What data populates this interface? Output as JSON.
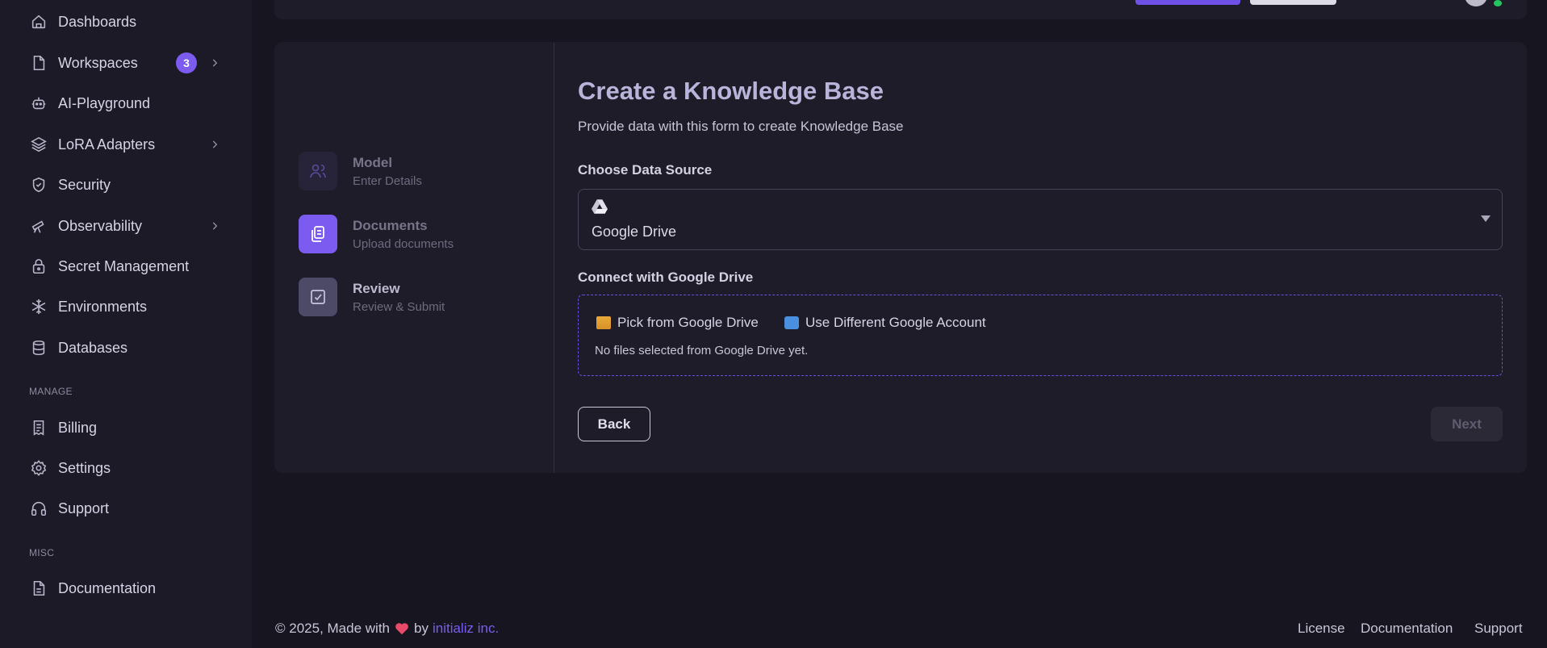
{
  "sidebar": {
    "items": [
      {
        "label": "Dashboards",
        "icon": "home-icon"
      },
      {
        "label": "Workspaces",
        "icon": "file-icon",
        "badge": "3"
      },
      {
        "label": "AI-Playground",
        "icon": "robot-icon"
      },
      {
        "label": "LoRA Adapters",
        "icon": "layers-icon"
      },
      {
        "label": "Security",
        "icon": "shield-check-icon"
      },
      {
        "label": "Observability",
        "icon": "telescope-icon"
      },
      {
        "label": "Secret Management",
        "icon": "lock-icon"
      },
      {
        "label": "Environments",
        "icon": "snowflake-icon"
      },
      {
        "label": "Databases",
        "icon": "database-icon"
      }
    ],
    "manage_heading": "MANAGE",
    "manage_items": [
      {
        "label": "Billing",
        "icon": "receipt-icon"
      },
      {
        "label": "Settings",
        "icon": "gear-icon"
      },
      {
        "label": "Support",
        "icon": "headphones-icon"
      }
    ],
    "misc_heading": "MISC",
    "misc_items": [
      {
        "label": "Documentation",
        "icon": "document-icon"
      }
    ]
  },
  "stepper": {
    "steps": [
      {
        "title": "Model",
        "subtitle": "Enter Details",
        "icon": "users-icon",
        "state": "done"
      },
      {
        "title": "Documents",
        "subtitle": "Upload documents",
        "icon": "copy-icon",
        "state": "active"
      },
      {
        "title": "Review",
        "subtitle": "Review & Submit",
        "icon": "check-square-icon",
        "state": "pending"
      }
    ]
  },
  "form": {
    "title": "Create a Knowledge Base",
    "subtitle": "Provide data with this form to create Knowledge Base",
    "source_label": "Choose Data Source",
    "source_value": "Google Drive",
    "connect_label": "Connect with Google Drive",
    "pick_label": "Pick from Google Drive",
    "switch_account_label": "Use Different Google Account",
    "empty_text": "No files selected from Google Drive yet.",
    "back_label": "Back",
    "next_label": "Next"
  },
  "footer": {
    "copyright": "© 2025, Made with",
    "by": "by",
    "company": "initializ inc.",
    "links": [
      "License",
      "Documentation",
      "Support"
    ]
  },
  "colors": {
    "accent": "#7c5cf0",
    "background": "#17151f",
    "card": "#1e1c28"
  }
}
